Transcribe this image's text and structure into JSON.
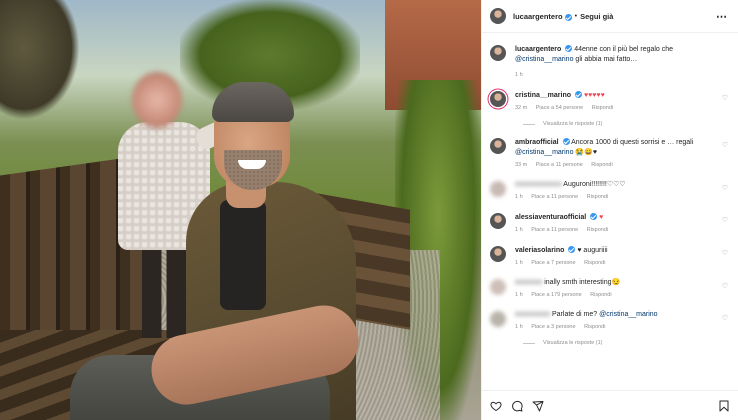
{
  "post": {
    "username": "lucaargentero",
    "follow_dot": "•",
    "follow_label": "Segui già",
    "more_icon": "⋯",
    "caption_user": "lucaargentero",
    "caption_text": "44enne con il più bel regalo che",
    "caption_mention": "@cristina__marino",
    "caption_text2": "gli abbia mai fatto…",
    "caption_time": "1 h"
  },
  "comments": [
    {
      "user": "cristina__marino",
      "verified": true,
      "text": "♥♥♥♥♥",
      "time": "32 m",
      "likes": "Piace a 54 persone",
      "reply": "Rispondi",
      "view_replies": "Visualizza le risposte (1)"
    },
    {
      "user": "ambraofficial",
      "verified": true,
      "text": "Ancora 1000 di questi sorrisi e … regali",
      "mention": "@cristina__marino",
      "emojis": "😭😄♥",
      "time": "33 m",
      "likes": "Piace a 11 persone",
      "reply": "Rispondi"
    },
    {
      "user": "",
      "text": "Auguroni!!!!!!!!♡♡♡",
      "time": "1 h",
      "likes": "Piace a 11 persone",
      "reply": "Rispondi"
    },
    {
      "user": "alessiaventuraofficial",
      "verified": true,
      "text": "♥",
      "time": "1 h",
      "likes": "Piace a 11 persone",
      "reply": "Rispondi"
    },
    {
      "user": "valeriasolarino",
      "verified": true,
      "text": "♥ auguriiii",
      "time": "1 h",
      "likes": "Piace a 7 persone",
      "reply": "Rispondi"
    },
    {
      "user": "",
      "text": "inally smth interesting😏",
      "time": "1 h",
      "likes": "Piace a 179 persone",
      "reply": "Rispondi"
    },
    {
      "user": "",
      "text": "Parlate di me?",
      "mention": "@cristina__marino",
      "time": "1 h",
      "likes": "Piace a 3 persone",
      "reply": "Rispondi",
      "view_replies": "Visualizza le risposte (1)"
    }
  ],
  "actions": {
    "like_icon": "heart-icon",
    "comment_icon": "comment-icon",
    "share_icon": "share-icon",
    "save_icon": "bookmark-icon"
  },
  "colors": {
    "verified": "#3897f0",
    "heart": "#ed4956",
    "mention": "#00376b",
    "meta": "#8e8e8e"
  }
}
